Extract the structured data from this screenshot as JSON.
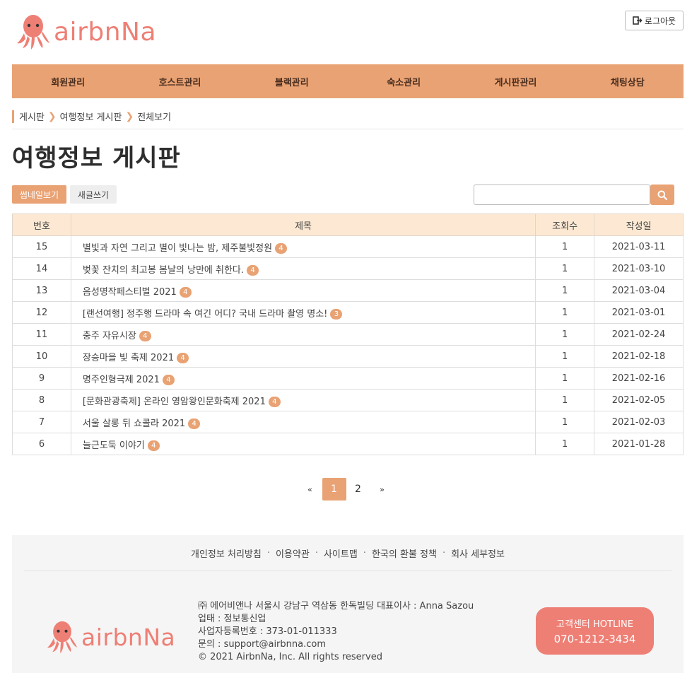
{
  "header": {
    "logo_text": "airbnNa",
    "logout_label": "로그아웃"
  },
  "nav": {
    "items": [
      "회원관리",
      "호스트관리",
      "블랙관리",
      "숙소관리",
      "게시판관리",
      "채팅상담"
    ]
  },
  "breadcrumb": {
    "items": [
      "게시판",
      "여행정보 게시판",
      "전체보기"
    ]
  },
  "page": {
    "title": "여행정보 게시판",
    "thumbnail_button": "썸네일보기",
    "write_button": "새글쓰기",
    "search_placeholder": ""
  },
  "table": {
    "headers": [
      "번호",
      "제목",
      "조회수",
      "작성일"
    ],
    "rows": [
      {
        "num": "15",
        "title": "별빛과 자연 그리고 별이 빛나는 밤, 제주불빛정원",
        "badge": "4",
        "views": "1",
        "date": "2021-03-11"
      },
      {
        "num": "14",
        "title": "벚꽃 잔치의 최고봉 봄날의 낭만에 취한다.",
        "badge": "4",
        "views": "1",
        "date": "2021-03-10"
      },
      {
        "num": "13",
        "title": "음성명작페스티벌 2021",
        "badge": "4",
        "views": "1",
        "date": "2021-03-04"
      },
      {
        "num": "12",
        "title": "[랜선여행] 정주행 드라마 속 여긴 어디? 국내 드라마 촬영 명소!",
        "badge": "3",
        "views": "1",
        "date": "2021-03-01"
      },
      {
        "num": "11",
        "title": "충주 자유시장",
        "badge": "4",
        "views": "1",
        "date": "2021-02-24"
      },
      {
        "num": "10",
        "title": "장승마을 빛 축제 2021",
        "badge": "4",
        "views": "1",
        "date": "2021-02-18"
      },
      {
        "num": "9",
        "title": "명주인형극제 2021",
        "badge": "4",
        "views": "1",
        "date": "2021-02-16"
      },
      {
        "num": "8",
        "title": "[문화관광축제] 온라인 영암왕인문화축제 2021",
        "badge": "4",
        "views": "1",
        "date": "2021-02-05"
      },
      {
        "num": "7",
        "title": "서울 살롱 뒤 쇼콜라 2021",
        "badge": "4",
        "views": "1",
        "date": "2021-02-03"
      },
      {
        "num": "6",
        "title": "늘근도둑 이야기",
        "badge": "4",
        "views": "1",
        "date": "2021-01-28"
      }
    ]
  },
  "pagination": {
    "prev": "«",
    "pages": [
      "1",
      "2"
    ],
    "current": "1",
    "next": "»"
  },
  "footer": {
    "links": [
      "개인정보 처리방침",
      "이용약관",
      "사이트맵",
      "한국의 환불 정책",
      "회사 세부정보"
    ],
    "logo_text": "airbnNa",
    "company_lines": [
      "㈜ 에어비앤나    서울시 강남구 역삼동 한독빌딩    대표이사 : Anna Sazou",
      "업태 : 정보통신업",
      "사업자등록번호 : 373-01-011333",
      "문의 : support@airbnna.com",
      "© 2021 AirbnNa, Inc. All rights reserved"
    ],
    "hotline_label": "고객센터 HOTLINE",
    "hotline_number": "070-1212-3434"
  },
  "colors": {
    "accent": "#e9a273",
    "logo": "#ee7f75",
    "table_header_bg": "#fde9d3"
  }
}
